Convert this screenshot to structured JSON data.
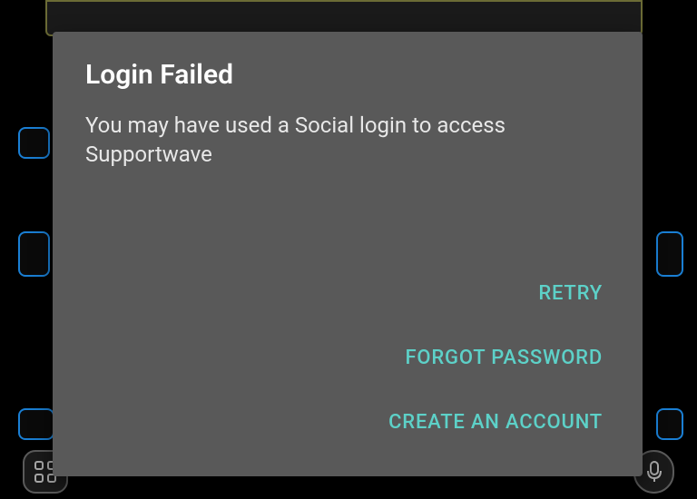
{
  "modal": {
    "title": "Login Failed",
    "body": "You may have used a Social login to access Supportwave",
    "actions": {
      "retry": "RETRY",
      "forgot_password": "FORGOT PASSWORD",
      "create_account": "CREATE AN ACCOUNT"
    }
  },
  "colors": {
    "accent": "#5dd1c8",
    "modal_bg": "#595959"
  }
}
